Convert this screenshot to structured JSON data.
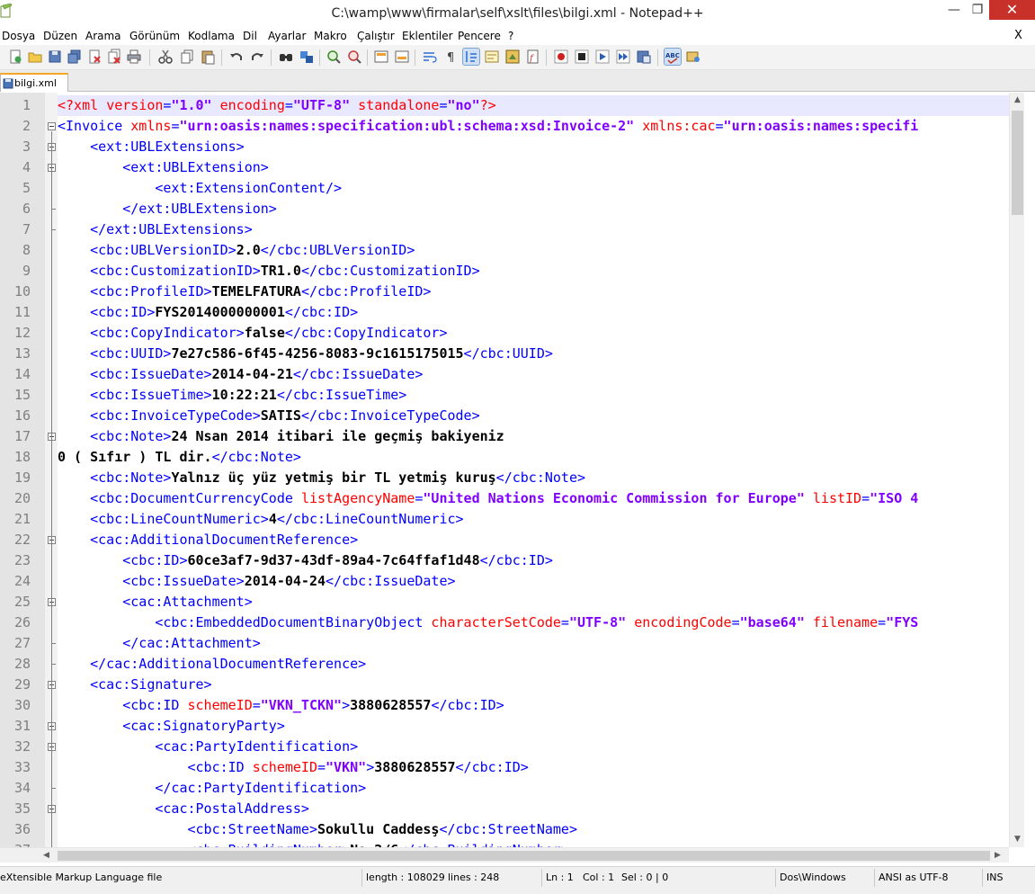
{
  "window": {
    "title": "C:\\wamp\\www\\firmalar\\self\\xslt\\files\\bilgi.xml - Notepad++",
    "minimize_glyph": "—",
    "maximize_glyph": "❐",
    "close_glyph": "✕"
  },
  "menu": {
    "items": [
      "Dosya",
      "Düzen",
      "Arama",
      "Görünüm",
      "Kodlama",
      "Dil",
      "Ayarlar",
      "Makro",
      "Çalıştır",
      "Eklentiler",
      "Pencere",
      "?"
    ],
    "close_label": "X"
  },
  "toolbar": {
    "icons": [
      "new-file-icon",
      "open-file-icon",
      "save-icon",
      "save-all-icon",
      "close-icon",
      "close-all-icon",
      "print-icon",
      "cut-icon",
      "copy-icon",
      "paste-icon",
      "undo-icon",
      "redo-icon",
      "find-icon",
      "replace-icon",
      "zoom-in-icon",
      "zoom-out-icon",
      "sync-vertical-icon",
      "sync-horizontal-icon",
      "word-wrap-icon",
      "show-all-chars-icon",
      "indent-guide-icon",
      "user-language-icon",
      "doc-map-icon",
      "function-list-icon",
      "record-macro-icon",
      "stop-macro-icon",
      "play-macro-icon",
      "run-macro-multiple-icon",
      "save-macro-icon",
      "spell-check-icon",
      "plugin-icon"
    ],
    "accent_color": "#2b6cd4"
  },
  "tabs": [
    {
      "label": "bilgi.xml",
      "active": true
    }
  ],
  "editor": {
    "lines": [
      {
        "n": "1",
        "current": true,
        "segs": [
          [
            "pi",
            "<?xml "
          ],
          [
            "attr",
            "version"
          ],
          [
            "tag",
            "="
          ],
          [
            "val",
            "\"1.0\""
          ],
          [
            "attr",
            " encoding"
          ],
          [
            "tag",
            "="
          ],
          [
            "val",
            "\"UTF-8\""
          ],
          [
            "attr",
            " standalone"
          ],
          [
            "tag",
            "="
          ],
          [
            "val",
            "\"no\""
          ],
          [
            "pi",
            "?>"
          ]
        ]
      },
      {
        "n": "2",
        "segs": [
          [
            "tag",
            "<Invoice "
          ],
          [
            "attr",
            "xmlns"
          ],
          [
            "tag",
            "="
          ],
          [
            "val",
            "\"urn:oasis:names:specification:ubl:schema:xsd:Invoice-2\""
          ],
          [
            "attr",
            " xmlns:cac"
          ],
          [
            "tag",
            "="
          ],
          [
            "val",
            "\"urn:oasis:names:specifi"
          ]
        ]
      },
      {
        "n": "3",
        "segs": [
          [
            "txt",
            "    "
          ],
          [
            "tag",
            "<ext:UBLExtensions>"
          ]
        ]
      },
      {
        "n": "4",
        "segs": [
          [
            "txt",
            "        "
          ],
          [
            "tag",
            "<ext:UBLExtension>"
          ]
        ]
      },
      {
        "n": "5",
        "segs": [
          [
            "txt",
            "            "
          ],
          [
            "tag",
            "<ext:ExtensionContent/>"
          ]
        ]
      },
      {
        "n": "6",
        "segs": [
          [
            "txt",
            "        "
          ],
          [
            "tag",
            "</ext:UBLExtension>"
          ]
        ]
      },
      {
        "n": "7",
        "segs": [
          [
            "txt",
            "    "
          ],
          [
            "tag",
            "</ext:UBLExtensions>"
          ]
        ]
      },
      {
        "n": "8",
        "segs": [
          [
            "txt",
            "    "
          ],
          [
            "tag",
            "<cbc:UBLVersionID>"
          ],
          [
            "txt",
            "2.0"
          ],
          [
            "tag",
            "</cbc:UBLVersionID>"
          ]
        ]
      },
      {
        "n": "9",
        "segs": [
          [
            "txt",
            "    "
          ],
          [
            "tag",
            "<cbc:CustomizationID>"
          ],
          [
            "txt",
            "TR1.0"
          ],
          [
            "tag",
            "</cbc:CustomizationID>"
          ]
        ]
      },
      {
        "n": "10",
        "segs": [
          [
            "txt",
            "    "
          ],
          [
            "tag",
            "<cbc:ProfileID>"
          ],
          [
            "txt",
            "TEMELFATURA"
          ],
          [
            "tag",
            "</cbc:ProfileID>"
          ]
        ]
      },
      {
        "n": "11",
        "segs": [
          [
            "txt",
            "    "
          ],
          [
            "tag",
            "<cbc:ID>"
          ],
          [
            "txt",
            "FYS2014000000001"
          ],
          [
            "tag",
            "</cbc:ID>"
          ]
        ]
      },
      {
        "n": "12",
        "segs": [
          [
            "txt",
            "    "
          ],
          [
            "tag",
            "<cbc:CopyIndicator>"
          ],
          [
            "txt",
            "false"
          ],
          [
            "tag",
            "</cbc:CopyIndicator>"
          ]
        ]
      },
      {
        "n": "13",
        "segs": [
          [
            "txt",
            "    "
          ],
          [
            "tag",
            "<cbc:UUID>"
          ],
          [
            "txt",
            "7e27c586-6f45-4256-8083-9c1615175015"
          ],
          [
            "tag",
            "</cbc:UUID>"
          ]
        ]
      },
      {
        "n": "14",
        "segs": [
          [
            "txt",
            "    "
          ],
          [
            "tag",
            "<cbc:IssueDate>"
          ],
          [
            "txt",
            "2014-04-21"
          ],
          [
            "tag",
            "</cbc:IssueDate>"
          ]
        ]
      },
      {
        "n": "15",
        "segs": [
          [
            "txt",
            "    "
          ],
          [
            "tag",
            "<cbc:IssueTime>"
          ],
          [
            "txt",
            "10:22:21"
          ],
          [
            "tag",
            "</cbc:IssueTime>"
          ]
        ]
      },
      {
        "n": "16",
        "segs": [
          [
            "txt",
            "    "
          ],
          [
            "tag",
            "<cbc:InvoiceTypeCode>"
          ],
          [
            "txt",
            "SATIS"
          ],
          [
            "tag",
            "</cbc:InvoiceTypeCode>"
          ]
        ]
      },
      {
        "n": "17",
        "segs": [
          [
            "txt",
            "    "
          ],
          [
            "tag",
            "<cbc:Note>"
          ],
          [
            "txt",
            "24 Nsan 2014 itibari ile geçmiş bakiyeniz"
          ]
        ]
      },
      {
        "n": "18",
        "segs": [
          [
            "txt",
            "0 ( Sıfır ) TL dir."
          ],
          [
            "tag",
            "</cbc:Note>"
          ]
        ]
      },
      {
        "n": "19",
        "segs": [
          [
            "txt",
            "    "
          ],
          [
            "tag",
            "<cbc:Note>"
          ],
          [
            "txt",
            "Yalnız üç yüz yetmiş bir TL yetmiş kuruş"
          ],
          [
            "tag",
            "</cbc:Note>"
          ]
        ]
      },
      {
        "n": "20",
        "segs": [
          [
            "txt",
            "    "
          ],
          [
            "tag",
            "<cbc:DocumentCurrencyCode "
          ],
          [
            "attr",
            "listAgencyName"
          ],
          [
            "tag",
            "="
          ],
          [
            "val",
            "\"United Nations Economic Commission for Europe\""
          ],
          [
            "attr",
            " listID"
          ],
          [
            "tag",
            "="
          ],
          [
            "val",
            "\"ISO 4"
          ]
        ]
      },
      {
        "n": "21",
        "segs": [
          [
            "txt",
            "    "
          ],
          [
            "tag",
            "<cbc:LineCountNumeric>"
          ],
          [
            "txt",
            "4"
          ],
          [
            "tag",
            "</cbc:LineCountNumeric>"
          ]
        ]
      },
      {
        "n": "22",
        "segs": [
          [
            "txt",
            "    "
          ],
          [
            "tag",
            "<cac:AdditionalDocumentReference>"
          ]
        ]
      },
      {
        "n": "23",
        "segs": [
          [
            "txt",
            "        "
          ],
          [
            "tag",
            "<cbc:ID>"
          ],
          [
            "txt",
            "60ce3af7-9d37-43df-89a4-7c64ffaf1d48"
          ],
          [
            "tag",
            "</cbc:ID>"
          ]
        ]
      },
      {
        "n": "24",
        "segs": [
          [
            "txt",
            "        "
          ],
          [
            "tag",
            "<cbc:IssueDate>"
          ],
          [
            "txt",
            "2014-04-24"
          ],
          [
            "tag",
            "</cbc:IssueDate>"
          ]
        ]
      },
      {
        "n": "25",
        "segs": [
          [
            "txt",
            "        "
          ],
          [
            "tag",
            "<cac:Attachment>"
          ]
        ]
      },
      {
        "n": "26",
        "segs": [
          [
            "txt",
            "            "
          ],
          [
            "tag",
            "<cbc:EmbeddedDocumentBinaryObject "
          ],
          [
            "attr",
            "characterSetCode"
          ],
          [
            "tag",
            "="
          ],
          [
            "val",
            "\"UTF-8\""
          ],
          [
            "attr",
            " encodingCode"
          ],
          [
            "tag",
            "="
          ],
          [
            "val",
            "\"base64\""
          ],
          [
            "attr",
            " filename"
          ],
          [
            "tag",
            "="
          ],
          [
            "val",
            "\"FYS"
          ]
        ]
      },
      {
        "n": "27",
        "segs": [
          [
            "txt",
            "        "
          ],
          [
            "tag",
            "</cac:Attachment>"
          ]
        ]
      },
      {
        "n": "28",
        "segs": [
          [
            "txt",
            "    "
          ],
          [
            "tag",
            "</cac:AdditionalDocumentReference>"
          ]
        ]
      },
      {
        "n": "29",
        "segs": [
          [
            "txt",
            "    "
          ],
          [
            "tag",
            "<cac:Signature>"
          ]
        ]
      },
      {
        "n": "30",
        "segs": [
          [
            "txt",
            "        "
          ],
          [
            "tag",
            "<cbc:ID "
          ],
          [
            "attr",
            "schemeID"
          ],
          [
            "tag",
            "="
          ],
          [
            "val",
            "\"VKN_TCKN\""
          ],
          [
            "tag",
            ">"
          ],
          [
            "txt",
            "3880628557"
          ],
          [
            "tag",
            "</cbc:ID>"
          ]
        ]
      },
      {
        "n": "31",
        "segs": [
          [
            "txt",
            "        "
          ],
          [
            "tag",
            "<cac:SignatoryParty>"
          ]
        ]
      },
      {
        "n": "32",
        "segs": [
          [
            "txt",
            "            "
          ],
          [
            "tag",
            "<cac:PartyIdentification>"
          ]
        ]
      },
      {
        "n": "33",
        "segs": [
          [
            "txt",
            "                "
          ],
          [
            "tag",
            "<cbc:ID "
          ],
          [
            "attr",
            "schemeID"
          ],
          [
            "tag",
            "="
          ],
          [
            "val",
            "\"VKN\""
          ],
          [
            "tag",
            ">"
          ],
          [
            "txt",
            "3880628557"
          ],
          [
            "tag",
            "</cbc:ID>"
          ]
        ]
      },
      {
        "n": "34",
        "segs": [
          [
            "txt",
            "            "
          ],
          [
            "tag",
            "</cac:PartyIdentification>"
          ]
        ]
      },
      {
        "n": "35",
        "segs": [
          [
            "txt",
            "            "
          ],
          [
            "tag",
            "<cac:PostalAddress>"
          ]
        ]
      },
      {
        "n": "36",
        "segs": [
          [
            "txt",
            "                "
          ],
          [
            "tag",
            "<cbc:StreetName>"
          ],
          [
            "txt",
            "Sokullu Caddesş"
          ],
          [
            "tag",
            "</cbc:StreetName>"
          ]
        ]
      },
      {
        "n": "37",
        "segs": [
          [
            "txt",
            "                "
          ],
          [
            "tag",
            "<cbc:BuildingNumber>"
          ],
          [
            "txt",
            "No:2/6"
          ],
          [
            "tag",
            "</cbc:BuildingNumber>"
          ]
        ]
      }
    ],
    "fold_boxes": [
      "2",
      "3",
      "4",
      "17",
      "22",
      "25",
      "29",
      "31",
      "32",
      "35"
    ],
    "colors": {
      "tag": "#0000ff",
      "attr": "#ff0000",
      "value": "#8000ff",
      "text": "#000000",
      "current_line": "#e8e8ff"
    }
  },
  "statusbar": {
    "file_type": "eXtensible Markup Language file",
    "length": "length : 108029",
    "lines": "lines : 248",
    "ln": "Ln : 1",
    "col": "Col : 1",
    "sel": "Sel : 0 | 0",
    "eol": "Dos\\Windows",
    "encoding": "ANSI as UTF-8",
    "mode": "INS"
  }
}
